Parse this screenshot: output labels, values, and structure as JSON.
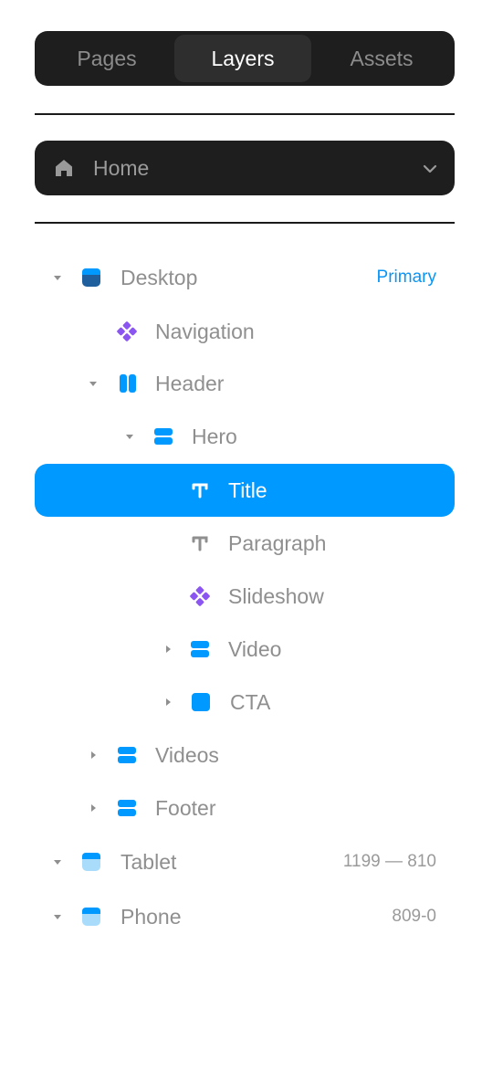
{
  "tabs": [
    {
      "label": "Pages"
    },
    {
      "label": "Layers"
    },
    {
      "label": "Assets"
    }
  ],
  "page_select": {
    "value": "Home"
  },
  "layers": {
    "desktop": {
      "label": "Desktop",
      "meta": "Primary"
    },
    "navigation": {
      "label": "Navigation"
    },
    "header": {
      "label": "Header"
    },
    "hero": {
      "label": "Hero"
    },
    "title": {
      "label": "Title"
    },
    "paragraph": {
      "label": "Paragraph"
    },
    "slideshow": {
      "label": "Slideshow"
    },
    "video": {
      "label": "Video"
    },
    "cta": {
      "label": "CTA"
    },
    "videos": {
      "label": "Videos"
    },
    "footer": {
      "label": "Footer"
    },
    "tablet": {
      "label": "Tablet",
      "meta": "1199 — 810"
    },
    "phone": {
      "label": "Phone",
      "meta": "809-0"
    }
  },
  "colors": {
    "panel": "#1e1e1e",
    "active_tab": "#2e2e2e",
    "selection": "#0099ff",
    "frame_blue": "#0099ff",
    "frame_dark": "#1f5f9e",
    "frame_light": "#7cc8f8",
    "component_purple": "#8a55f0",
    "text_muted": "#8f8f8f"
  },
  "icons": {
    "home": "home-icon",
    "dropdown": "chevron-down-icon",
    "expand": "caret-icon",
    "frame": "frame-icon",
    "component": "component-icon",
    "text": "text-icon"
  }
}
